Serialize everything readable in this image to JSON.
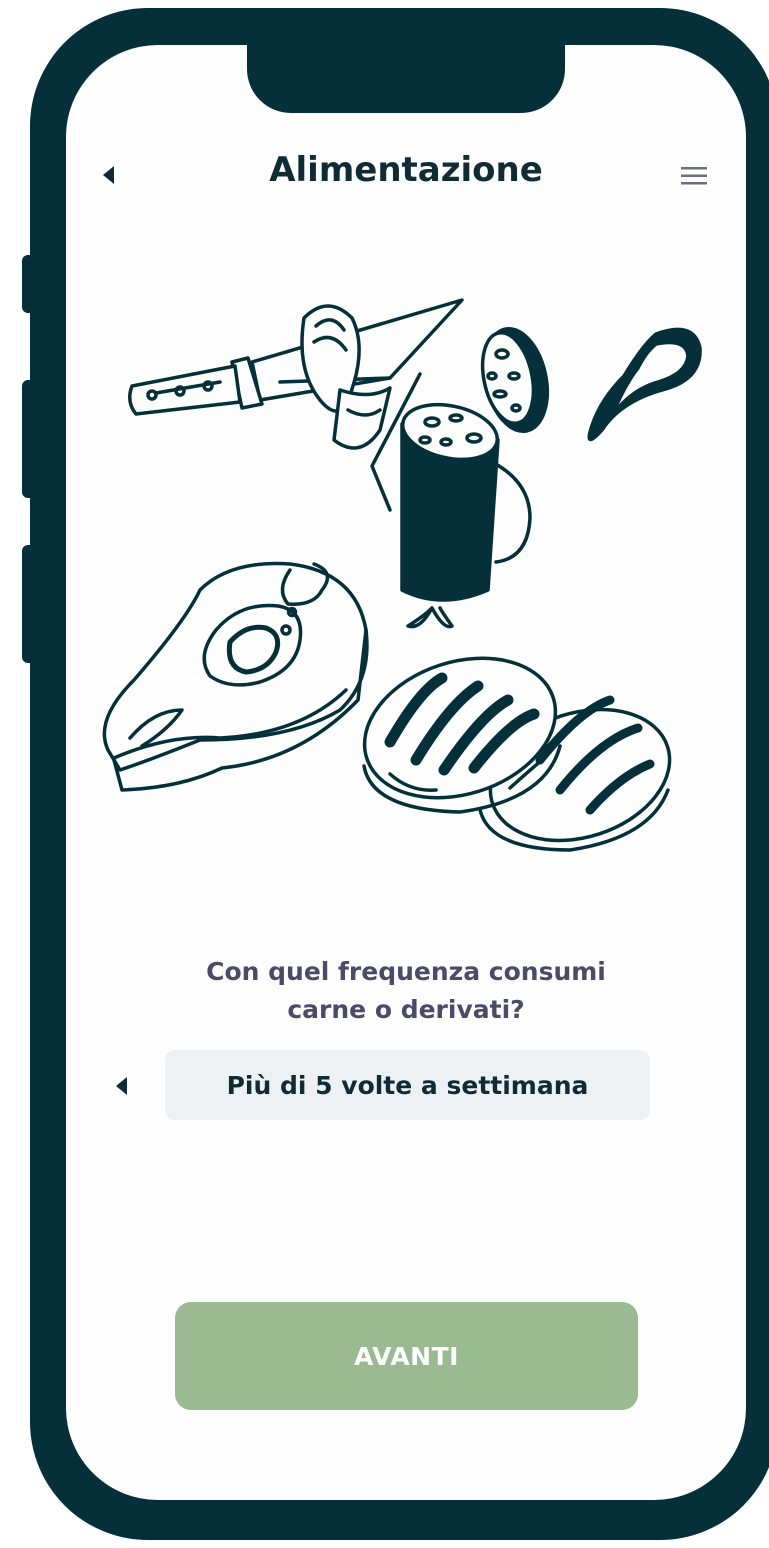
{
  "header": {
    "back_icon": "chevron-left-icon",
    "title": "Alimentazione",
    "menu_icon": "hamburger-menu-icon"
  },
  "illustration": {
    "subject": "meat-illustration",
    "items": [
      "knife",
      "ham-slice",
      "salami",
      "salami-slice",
      "sausage-ring",
      "steak",
      "grilled-patties"
    ]
  },
  "question": {
    "line1": "Con quel frequenza consumi",
    "line2": "carne o derivati?"
  },
  "answer_select": {
    "prev_icon": "chevron-left-icon",
    "value": "Più di 5 volte a settimana"
  },
  "footer": {
    "next_label": "AVANTI"
  },
  "colors": {
    "frame": "#05303a",
    "ink": "#0f2b33",
    "question_text": "#4b4a69",
    "select_bg": "#eef1f3",
    "button_bg": "#9aba91"
  }
}
